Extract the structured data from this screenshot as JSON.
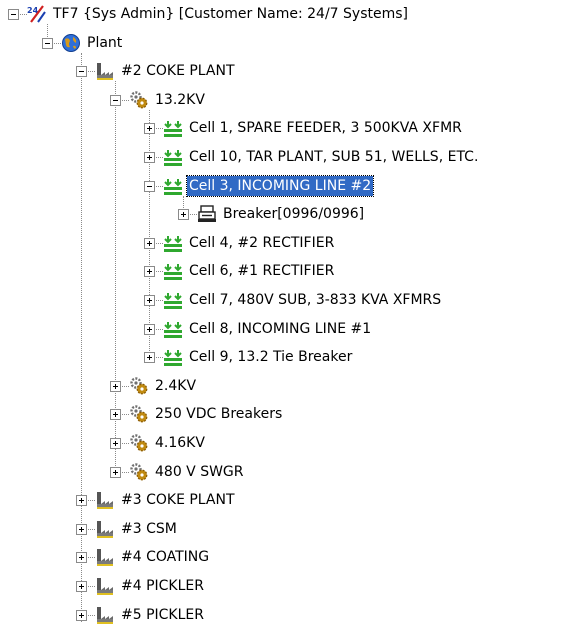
{
  "tree": {
    "root": {
      "label": "TF7 {Sys Admin} [Customer Name: 24/7 Systems]",
      "icon": "tf7-app-icon",
      "expanded": true,
      "children": [
        {
          "label": "Plant",
          "icon": "globe-icon",
          "expanded": true,
          "children": [
            {
              "label": "#2 COKE PLANT",
              "icon": "factory-icon",
              "expanded": true,
              "children": [
                {
                  "label": "13.2KV",
                  "icon": "gears-icon",
                  "expanded": true,
                  "children": [
                    {
                      "label": "Cell 1, SPARE FEEDER, 3 500KVA XFMR",
                      "icon": "cell-icon",
                      "expanded": false
                    },
                    {
                      "label": "Cell 10, TAR PLANT, SUB 51, WELLS, ETC.",
                      "icon": "cell-icon",
                      "expanded": false
                    },
                    {
                      "label": "Cell 3, INCOMING LINE #2",
                      "icon": "cell-icon",
                      "expanded": true,
                      "selected": true,
                      "children": [
                        {
                          "label": "Breaker[0996/0996]",
                          "icon": "breaker-icon",
                          "expanded": false
                        }
                      ]
                    },
                    {
                      "label": "Cell 4, #2 RECTIFIER",
                      "icon": "cell-icon",
                      "expanded": false
                    },
                    {
                      "label": "Cell 6, #1 RECTIFIER",
                      "icon": "cell-icon",
                      "expanded": false
                    },
                    {
                      "label": "Cell 7, 480V SUB, 3-833 KVA XFMRS",
                      "icon": "cell-icon",
                      "expanded": false
                    },
                    {
                      "label": "Cell 8, INCOMING LINE #1",
                      "icon": "cell-icon",
                      "expanded": false
                    },
                    {
                      "label": "Cell 9, 13.2 Tie Breaker",
                      "icon": "cell-icon",
                      "expanded": false
                    }
                  ]
                },
                {
                  "label": "2.4KV",
                  "icon": "gears-icon",
                  "expanded": false
                },
                {
                  "label": "250 VDC Breakers",
                  "icon": "gears-icon",
                  "expanded": false
                },
                {
                  "label": "4.16KV",
                  "icon": "gears-icon",
                  "expanded": false
                },
                {
                  "label": "480 V SWGR",
                  "icon": "gears-icon",
                  "expanded": false
                }
              ]
            },
            {
              "label": "#3 COKE PLANT",
              "icon": "factory-icon",
              "expanded": false
            },
            {
              "label": "#3 CSM",
              "icon": "factory-icon",
              "expanded": false
            },
            {
              "label": "#4 COATING",
              "icon": "factory-icon",
              "expanded": false
            },
            {
              "label": "#4 PICKLER",
              "icon": "factory-icon",
              "expanded": false
            },
            {
              "label": "#5 PICKLER",
              "icon": "factory-icon",
              "expanded": false
            }
          ]
        }
      ]
    }
  },
  "colors": {
    "selection_bg": "#316ac5",
    "selection_fg": "#ffffff",
    "tree_lines": "#8a8a8a",
    "cell_icon_green": "#2fa82f",
    "gear_gold": "#c08a10"
  }
}
